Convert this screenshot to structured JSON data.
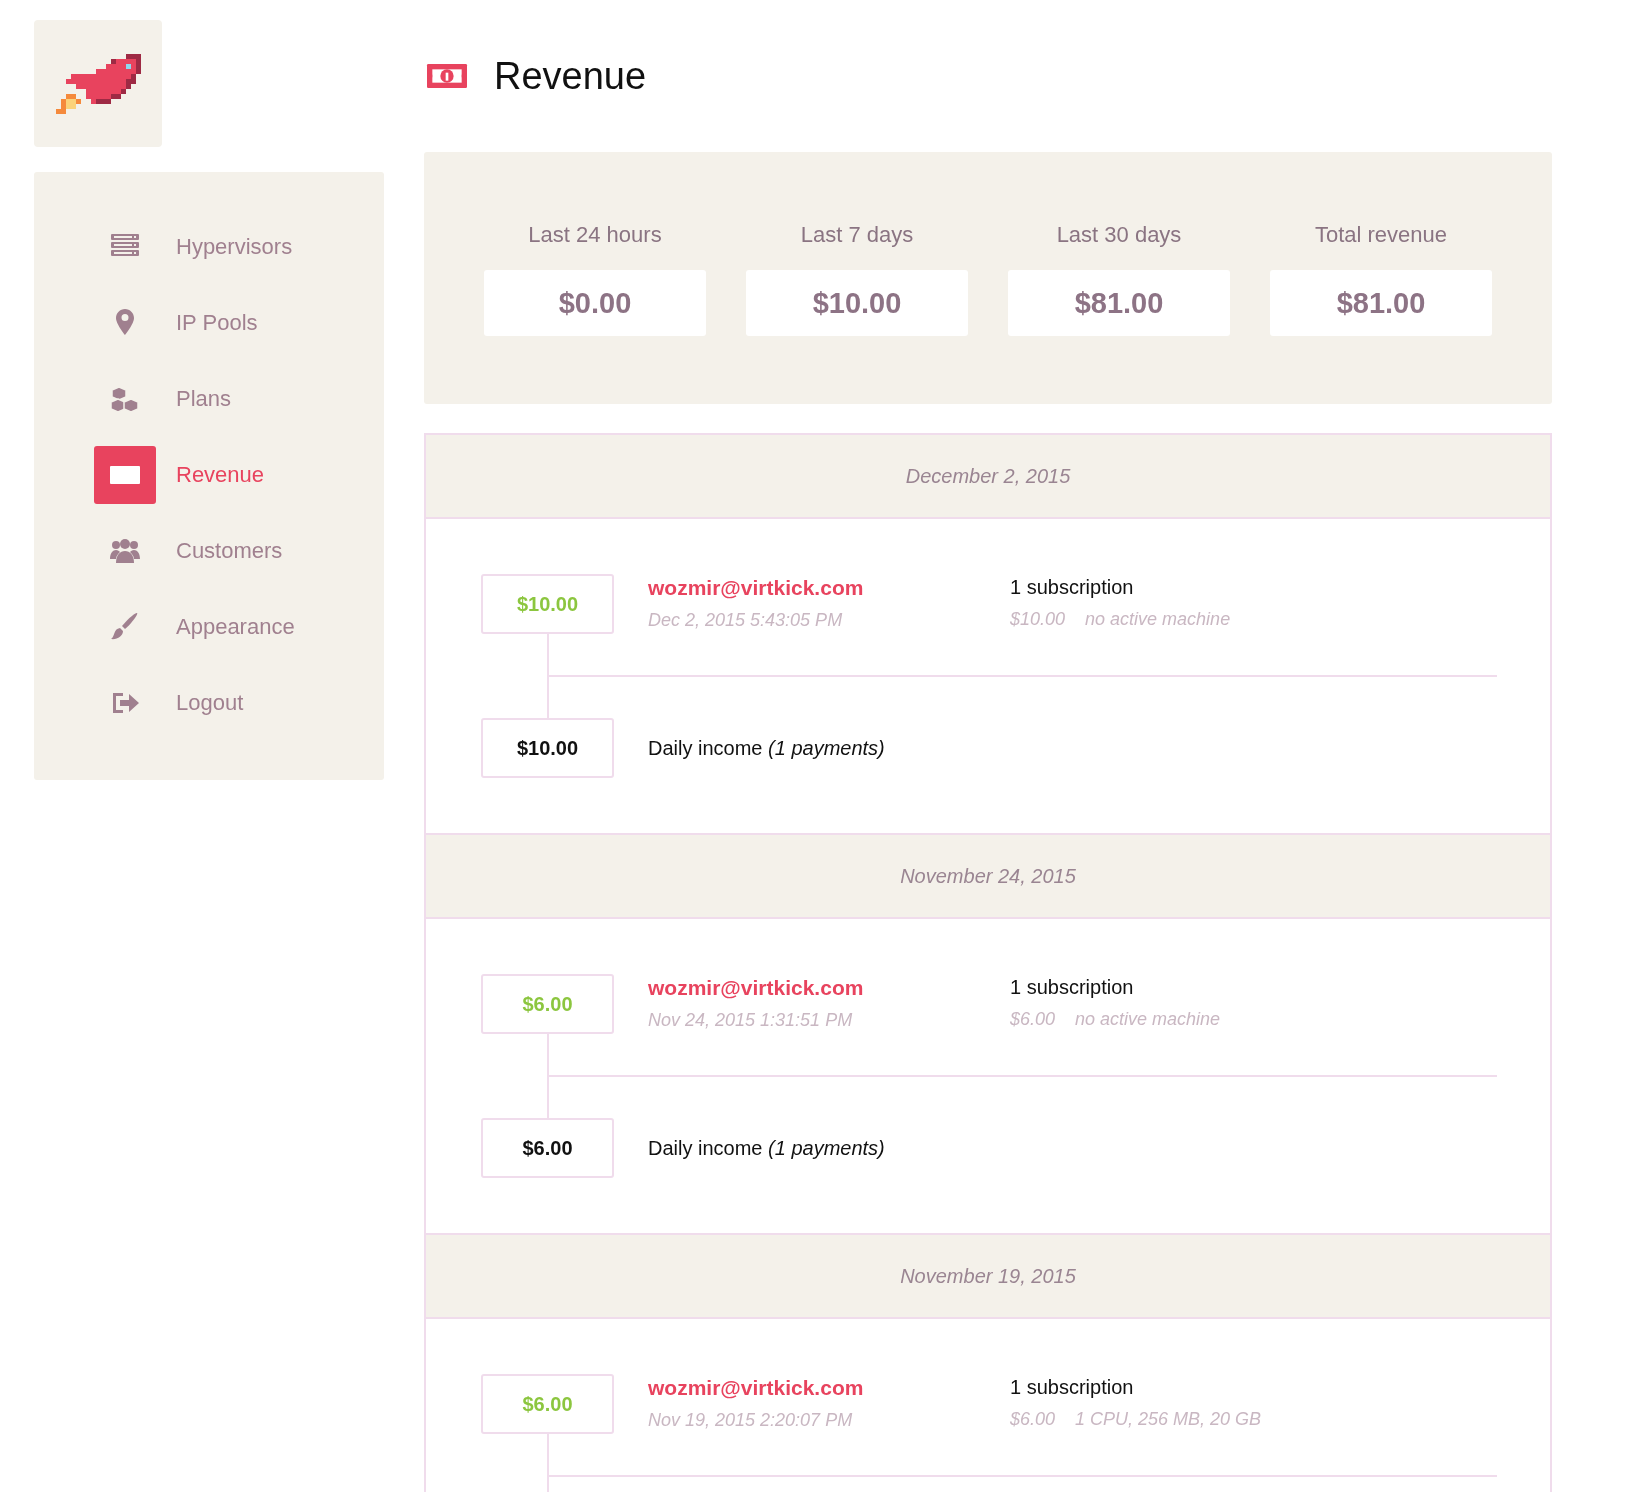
{
  "sidebar": {
    "items": [
      {
        "label": "Hypervisors",
        "selected": false
      },
      {
        "label": "IP Pools",
        "selected": false
      },
      {
        "label": "Plans",
        "selected": false
      },
      {
        "label": "Revenue",
        "selected": true
      },
      {
        "label": "Customers",
        "selected": false
      },
      {
        "label": "Appearance",
        "selected": false
      },
      {
        "label": "Logout",
        "selected": false
      }
    ]
  },
  "page_title": "Revenue",
  "stats": [
    {
      "label": "Last 24 hours",
      "value": "$0.00"
    },
    {
      "label": "Last 7 days",
      "value": "$10.00"
    },
    {
      "label": "Last 30 days",
      "value": "$81.00"
    },
    {
      "label": "Total revenue",
      "value": "$81.00"
    }
  ],
  "days": [
    {
      "date": "December 2, 2015",
      "payments": [
        {
          "amount": "$10.00",
          "email": "wozmir@virtkick.com",
          "time": "Dec 2, 2015 5:43:05 PM",
          "summary": "1 subscription",
          "price": "$10.00",
          "machine": "no active machine"
        }
      ],
      "daily_income": {
        "amount": "$10.00",
        "label": "Daily income *(1 payments)*"
      }
    },
    {
      "date": "November 24, 2015",
      "payments": [
        {
          "amount": "$6.00",
          "email": "wozmir@virtkick.com",
          "time": "Nov 24, 2015 1:31:51 PM",
          "summary": "1 subscription",
          "price": "$6.00",
          "machine": "no active machine"
        }
      ],
      "daily_income": {
        "amount": "$6.00",
        "label": "Daily income *(1 payments)*"
      }
    },
    {
      "date": "November 19, 2015",
      "payments": [
        {
          "amount": "$6.00",
          "email": "wozmir@virtkick.com",
          "time": "Nov 19, 2015 2:20:07 PM",
          "summary": "1 subscription",
          "price": "$6.00",
          "machine": "1 CPU, 256 MB, 20 GB"
        }
      ]
    }
  ]
}
